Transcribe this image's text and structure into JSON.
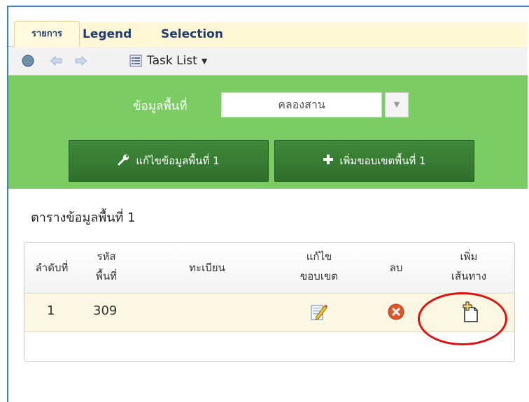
{
  "tabs": [
    {
      "label": "รายการ"
    },
    {
      "label": "Legend"
    },
    {
      "label": "Selection"
    }
  ],
  "toolbar": {
    "task_list_label": "Task List",
    "icons": [
      "globe-icon",
      "back-arrow-icon",
      "forward-arrow-icon",
      "task-list-icon",
      "chevron-down-icon"
    ]
  },
  "area_filter": {
    "label": "ข้อมูลพื้นที่",
    "selected": "คลองสาน"
  },
  "buttons": {
    "edit_area": "แก้ไขข้อมูลพื้นที่ 1",
    "add_boundary": "เพิ่มขอบเขตพื้นที่ 1"
  },
  "section_title": "ตารางข้อมูลพื้นที่ 1",
  "table": {
    "headers": {
      "seq": "ลำดับที่",
      "area_code_1": "รหัส",
      "area_code_2": "พื้นที่",
      "registry": "ทะเบียน",
      "edit_boundary_1": "แก้ไข",
      "edit_boundary_2": "ขอบเขต",
      "delete": "ลบ",
      "add_route_1": "เพิ่ม",
      "add_route_2": "เส้นทาง"
    },
    "rows": [
      {
        "seq": "1",
        "area_code": "309",
        "registry": ""
      }
    ]
  },
  "colors": {
    "tab_text": "#1f3f73",
    "green_panel": "#7acc63",
    "green_button": "#3f8a3a",
    "highlight": "#e01010"
  }
}
